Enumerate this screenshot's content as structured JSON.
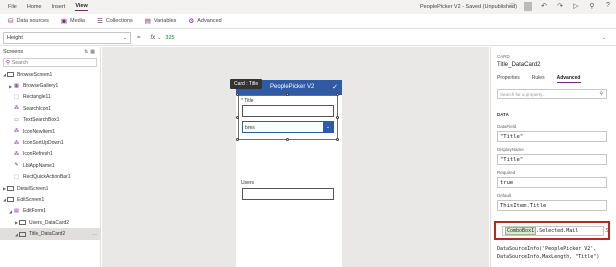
{
  "menubar": {
    "items": [
      "File",
      "Home",
      "Insert",
      "View"
    ],
    "active": "View",
    "app_status": "PeoplePicker V2 - Saved (Unpublished)"
  },
  "ribbon": {
    "buttons": [
      {
        "label": "Data sources",
        "icon": "database-icon"
      },
      {
        "label": "Media",
        "icon": "media-icon"
      },
      {
        "label": "Collections",
        "icon": "collections-icon"
      },
      {
        "label": "Variables",
        "icon": "variables-icon"
      },
      {
        "label": "Advanced",
        "icon": "advanced-icon"
      }
    ]
  },
  "formula": {
    "property": "Height",
    "eq": "=",
    "fx": "fx",
    "value": "325"
  },
  "tree": {
    "header": "Screens",
    "search_placeholder": "Search",
    "nodes": [
      {
        "label": "BrowseScreen1",
        "icon": "screen-icon"
      },
      {
        "label": "BrowseGallery1",
        "icon": "gallery-icon"
      },
      {
        "label": "Rectangle11",
        "icon": "rectangle-icon"
      },
      {
        "label": "SearchIcon1",
        "icon": "search-icon"
      },
      {
        "label": "TextSearchBox1",
        "icon": "textbox-icon"
      },
      {
        "label": "IconNewItem1",
        "icon": "add-icon"
      },
      {
        "label": "IconSortUpDown1",
        "icon": "sort-icon"
      },
      {
        "label": "IconRefresh1",
        "icon": "refresh-icon"
      },
      {
        "label": "LblAppName1",
        "icon": "label-icon"
      },
      {
        "label": "RectQuickActionBar1",
        "icon": "rectangle-icon"
      },
      {
        "label": "DetailScreen1",
        "icon": "screen-icon"
      },
      {
        "label": "EditScreen1",
        "icon": "screen-icon"
      },
      {
        "label": "EditForm1",
        "icon": "form-icon"
      },
      {
        "label": "Users_DataCard2",
        "icon": "card-icon"
      },
      {
        "label": "Title_DataCard2",
        "icon": "card-icon"
      }
    ]
  },
  "canvas": {
    "app_title": "PeoplePicker V2",
    "card_badge": "Card : Title",
    "title_label": "* Title",
    "dropdown_value": "bres",
    "users_label": "Users"
  },
  "panel": {
    "kind": "CARD",
    "title": "Title_DataCard2",
    "tabs": [
      "Properties",
      "Rules",
      "Advanced"
    ],
    "active_tab": "Advanced",
    "search_placeholder": "Search for a property...",
    "section": "DATA",
    "datafield_label": "DataField",
    "datafield_value": "\"Title\"",
    "displayname_label": "DisplayName",
    "displayname_value": "\"Title\"",
    "required_label": "Required",
    "required_value": "true",
    "default_label": "Default",
    "default_value": "ThisItem.Title",
    "update_token": "ComboBox1",
    "update_rest": ".Selected.Mail",
    "code_line1": "DataSourceInfo('PeoplePicker V2',",
    "code_line2": "DataSourceInfo.MaxLength, \"Title\")"
  },
  "colors": {
    "accent": "#742774",
    "header_blue": "#2f5aa5",
    "highlight_red": "#b32a1e"
  }
}
